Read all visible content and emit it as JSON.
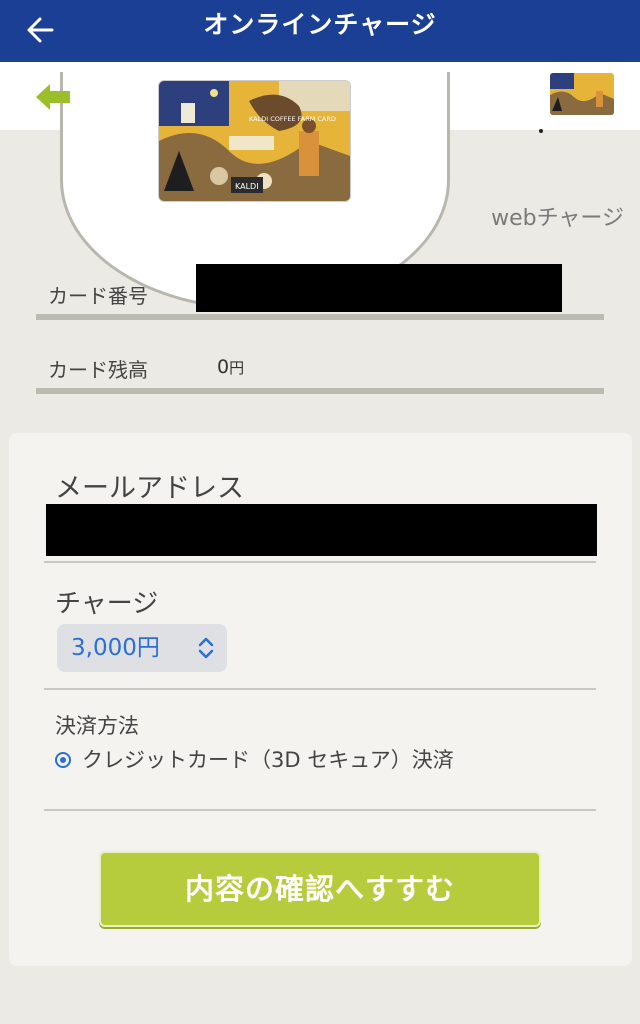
{
  "header": {
    "title": "オンラインチャージ"
  },
  "card_area": {
    "web_charge_label": "webチャージ"
  },
  "info": {
    "card_number_label": "カード番号",
    "balance_label": "カード残高",
    "balance_value": "0",
    "balance_unit": "円"
  },
  "form": {
    "email_label": "メールアドレス",
    "charge_label": "チャージ",
    "charge_selected": "3,000円",
    "payment_label": "決済方法",
    "payment_option": "クレジットカード（3D セキュア）決済",
    "submit_label": "内容の確認へすすむ"
  },
  "colors": {
    "header_bg": "#1b3f95",
    "accent_green": "#b7cc3c",
    "link_blue": "#2a6fd6"
  }
}
